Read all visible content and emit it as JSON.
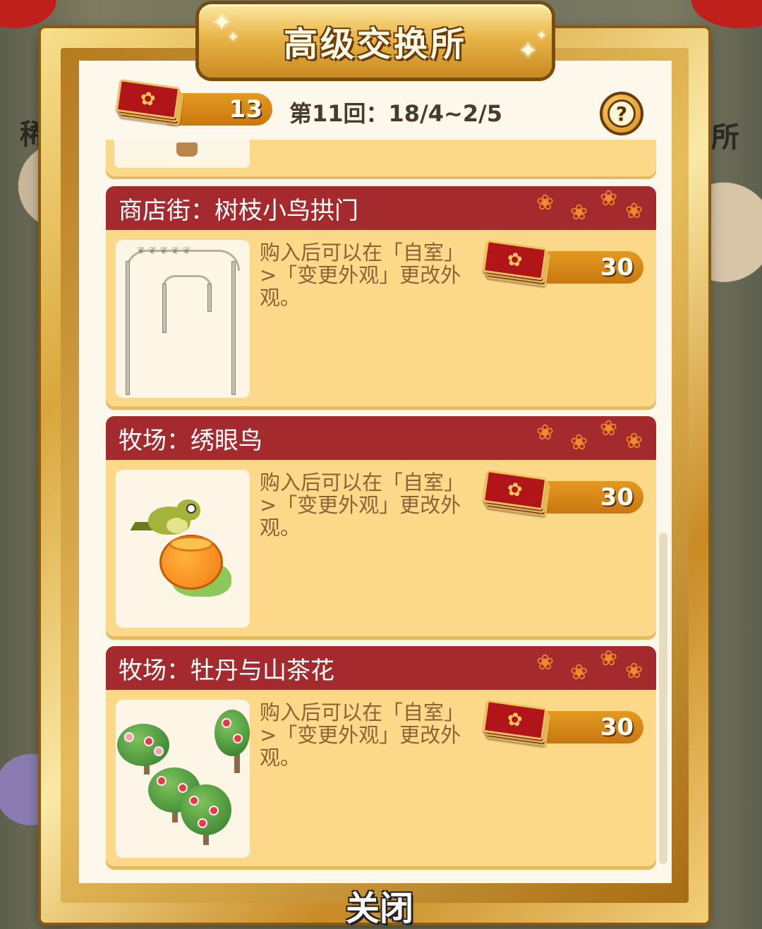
{
  "title": "高级交换所",
  "header": {
    "ticket_count": "13",
    "round_text": "第11回：18/4~2/5",
    "help_glyph": "?",
    "ticket_icon": "rose-ticket-icon"
  },
  "background": {
    "left_text": "稀",
    "right_text": "所"
  },
  "items": [
    {
      "name": "商店街：树枝小鸟拱门",
      "description": "购入后可以在「自室」>「变更外观」更改外观。",
      "price": "30",
      "image": "branch-bird-arch"
    },
    {
      "name": "牧场：绣眼鸟",
      "description": "购入后可以在「自室」>「变更外观」更改外观。",
      "price": "30",
      "image": "white-eye-bird-on-orange"
    },
    {
      "name": "牧场：牡丹与山茶花",
      "description": "购入后可以在「自室」>「变更外观」更改外观。",
      "price": "30",
      "image": "peony-and-camellia-bushes"
    }
  ],
  "footer": {
    "close_label": "关闭"
  },
  "colors": {
    "header_red": "#a42a2e",
    "card_yellow": "#fbd989",
    "pill_orange": "#e39a20",
    "frame_gold": "#d9a63c"
  }
}
